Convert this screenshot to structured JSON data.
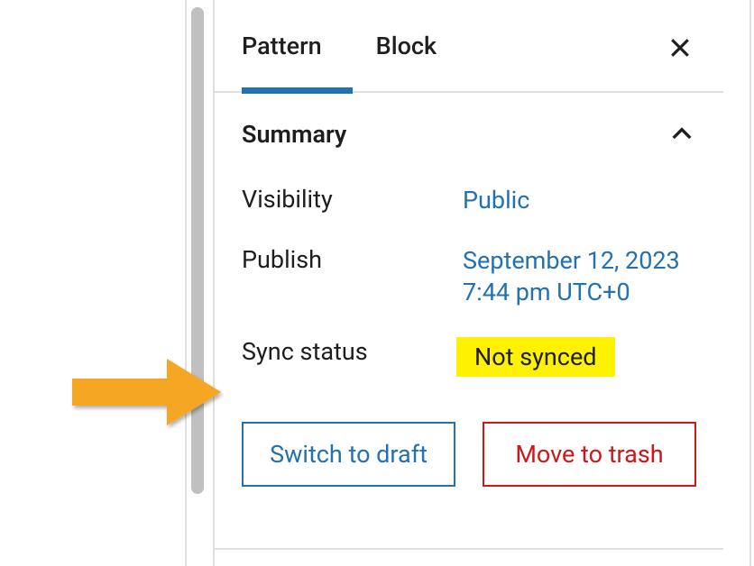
{
  "tabs": {
    "pattern": "Pattern",
    "block": "Block"
  },
  "summary": {
    "title": "Summary",
    "visibility_label": "Visibility",
    "visibility_value": "Public",
    "publish_label": "Publish",
    "publish_value": "September 12, 2023 7:44 pm UTC+0",
    "sync_label": "Sync status",
    "sync_value": "Not synced"
  },
  "buttons": {
    "draft": "Switch to draft",
    "trash": "Move to trash"
  }
}
